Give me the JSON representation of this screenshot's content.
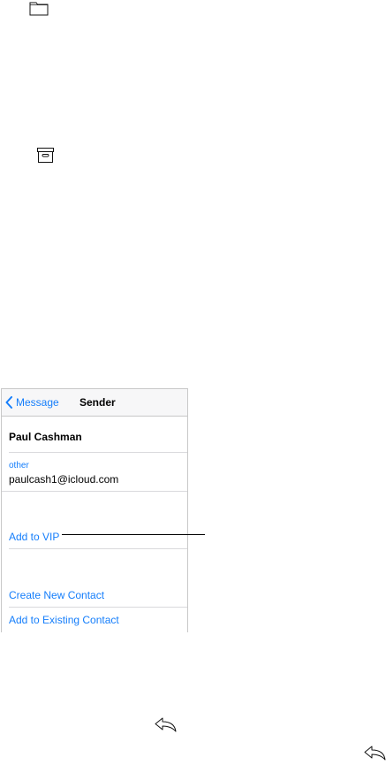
{
  "navbar": {
    "back_label": "Message",
    "title": "Sender"
  },
  "contact": {
    "name": "Paul Cashman",
    "email_label": "other",
    "email": "paulcash1@icloud.com"
  },
  "actions": {
    "add_vip": "Add to VIP",
    "create_contact": "Create New Contact",
    "add_existing": "Add to Existing Contact"
  },
  "icons": {
    "folder": "folder-icon",
    "archive": "archive-box-icon",
    "reply": "reply-arrow-icon",
    "back": "chevron-left-icon"
  },
  "colors": {
    "accent": "#157efb",
    "separator": "#d9d9dc",
    "navbar_bg": "#f7f7f8"
  }
}
